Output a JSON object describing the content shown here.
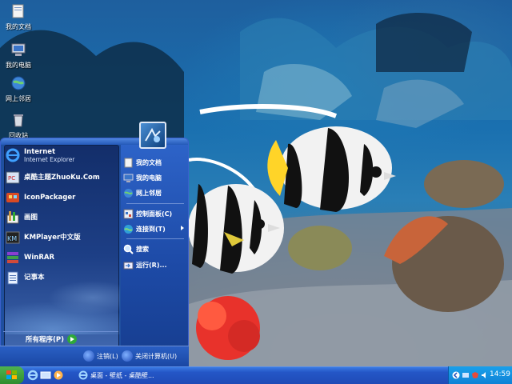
{
  "desktop": {
    "icons": [
      {
        "label": "我的文档",
        "icon": "my-documents-icon"
      },
      {
        "label": "我的电脑",
        "icon": "my-computer-icon"
      },
      {
        "label": "网上邻居",
        "icon": "network-places-icon"
      },
      {
        "label": "回收站",
        "icon": "recycle-bin-icon"
      }
    ]
  },
  "start_menu": {
    "pinned": [
      {
        "label": "Internet",
        "sub": "Internet Explorer",
        "icon": "internet-explorer-icon"
      },
      {
        "label": "桌酷主题ZhuoKu.Com",
        "icon": "zhuoku-icon"
      },
      {
        "label": "IconPackager",
        "icon": "iconpackager-icon"
      },
      {
        "label": "画图",
        "icon": "paint-icon"
      },
      {
        "label": "KMPlayer中文版",
        "icon": "kmplayer-icon"
      },
      {
        "label": "WinRAR",
        "icon": "winrar-icon"
      },
      {
        "label": "记事本",
        "icon": "notepad-icon"
      }
    ],
    "all_programs": "所有程序(P)",
    "right_items": [
      {
        "label": "我的文档",
        "icon": "my-documents-icon"
      },
      {
        "label": "我的电脑",
        "icon": "my-computer-icon"
      },
      {
        "label": "网上邻居",
        "icon": "network-places-icon"
      },
      {
        "label": "控制面板(C)",
        "icon": "control-panel-icon"
      },
      {
        "label": "连接到(T)",
        "icon": "connect-to-icon"
      },
      {
        "label": "搜索",
        "icon": "search-icon"
      },
      {
        "label": "运行(R)...",
        "icon": "run-icon"
      }
    ],
    "logoff": "注销(L)",
    "shutdown": "关闭计算机(U)"
  },
  "taskbar": {
    "task_button": "桌面 - 壁纸 - 桌酷壁...",
    "clock": "14:59",
    "colors": {
      "start_green": "#2f8d2f",
      "taskbar_blue": "#2456c6",
      "tray_blue": "#0f82d6"
    }
  }
}
